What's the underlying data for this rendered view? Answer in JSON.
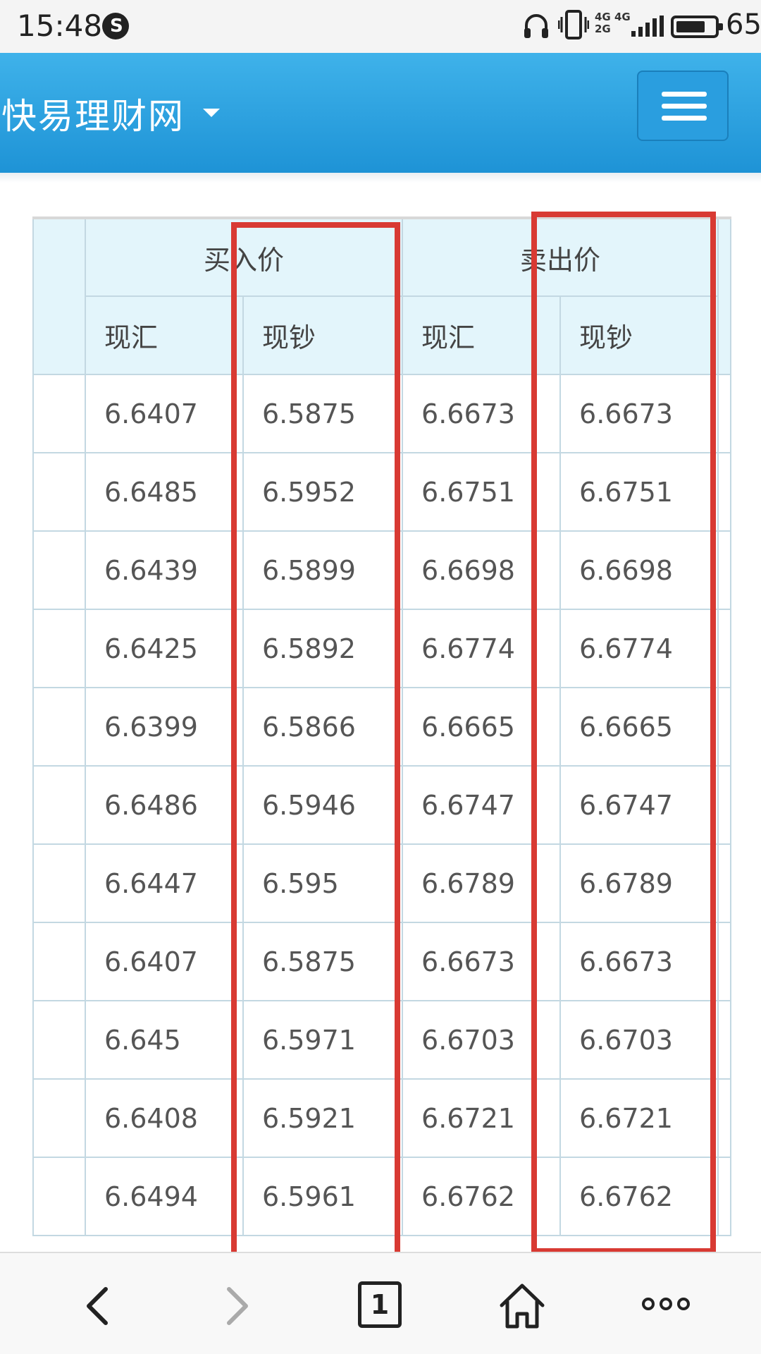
{
  "status_bar": {
    "time": "15:48",
    "network_top": "4G 4G",
    "network_bottom": "2G",
    "battery": "65",
    "icons": [
      "app-badge-icon",
      "headphone-icon",
      "vibrate-icon",
      "signal-icon",
      "battery-icon"
    ]
  },
  "navbar": {
    "brand": "快易理财网",
    "menu_icon": "hamburger-icon"
  },
  "table": {
    "group_headers": [
      "买入价",
      "卖出价"
    ],
    "sub_headers": [
      "现汇",
      "现钞",
      "现汇",
      "现钞"
    ],
    "rows": [
      [
        "6.6407",
        "6.5875",
        "6.6673",
        "6.6673"
      ],
      [
        "6.6485",
        "6.5952",
        "6.6751",
        "6.6751"
      ],
      [
        "6.6439",
        "6.5899",
        "6.6698",
        "6.6698"
      ],
      [
        "6.6425",
        "6.5892",
        "6.6774",
        "6.6774"
      ],
      [
        "6.6399",
        "6.5866",
        "6.6665",
        "6.6665"
      ],
      [
        "6.6486",
        "6.5946",
        "6.6747",
        "6.6747"
      ],
      [
        "6.6447",
        "6.595",
        "6.6789",
        "6.6789"
      ],
      [
        "6.6407",
        "6.5875",
        "6.6673",
        "6.6673"
      ],
      [
        "6.645",
        "6.5971",
        "6.6703",
        "6.6703"
      ],
      [
        "6.6408",
        "6.5921",
        "6.6721",
        "6.6721"
      ],
      [
        "6.6494",
        "6.5961",
        "6.6762",
        "6.6762"
      ]
    ]
  },
  "highlight_color": "#d83a33",
  "header_bg": "#e3f5fb",
  "navbar_color": "#2a9edf",
  "bottom_bar": {
    "tab_count": "1",
    "icons": [
      "back-arrow-icon",
      "forward-arrow-icon",
      "tabs-icon",
      "home-icon",
      "more-dots-icon"
    ]
  }
}
